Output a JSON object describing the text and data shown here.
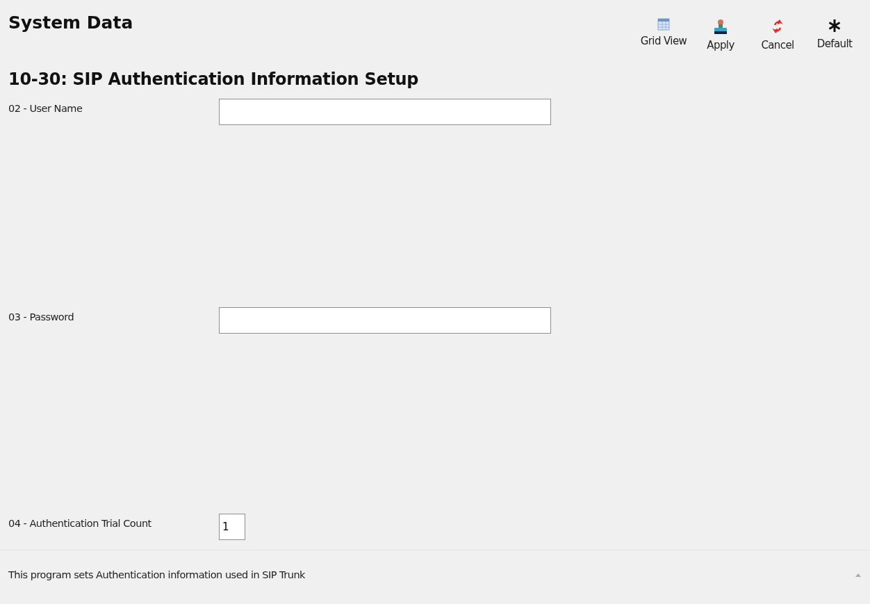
{
  "header": {
    "title": "System Data"
  },
  "toolbar": [
    {
      "label": "Grid View",
      "kind": "grid"
    },
    {
      "label": "Apply",
      "kind": "apply"
    },
    {
      "label": "Cancel",
      "kind": "cancel"
    },
    {
      "label": "Default",
      "kind": "default"
    }
  ],
  "section": {
    "title": "10-30: SIP Authentication Information Setup"
  },
  "fields": [
    {
      "label": "02 - User Name",
      "kind": "wide"
    },
    {
      "label": "03 - Password",
      "kind": "wide"
    },
    {
      "label": "04 - Authentication Trial Count",
      "kind": "short",
      "value": "1"
    }
  ],
  "description": "This program sets Authentication information used in SIP Trunk"
}
